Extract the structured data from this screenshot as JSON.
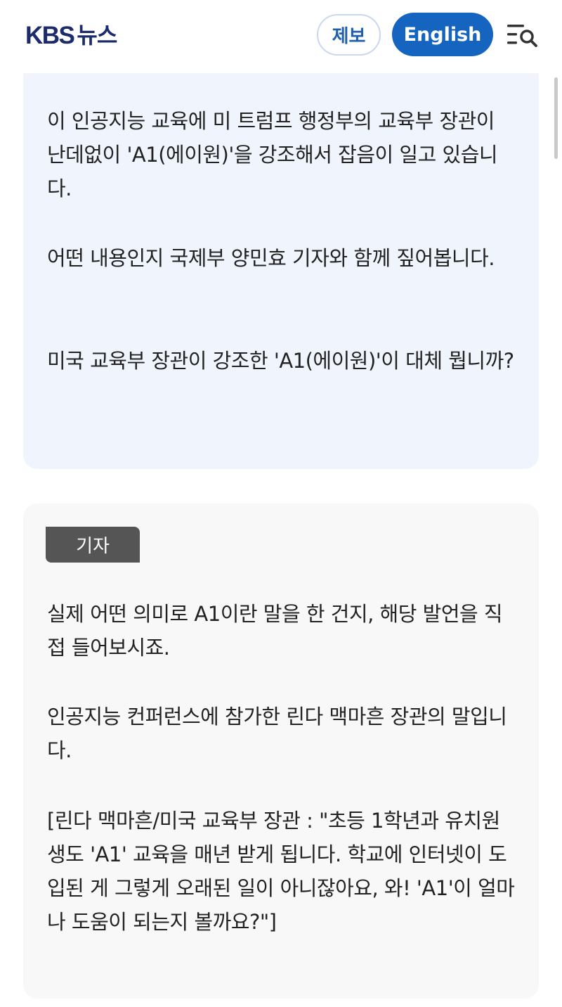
{
  "header": {
    "logo_kbs": "KBS",
    "logo_news": "뉴스",
    "tip_button": "제보",
    "english_button": "English",
    "menu_icon": "menu-search-icon",
    "reading_progress": 0.21,
    "colors": {
      "brand": "#1c2b6b",
      "accent": "#1565c0",
      "progress": "#2f92d6"
    }
  },
  "anchor_card": {
    "paragraphs": [
      "이 인공지능 교육에 미 트럼프 행정부의 교육부 장관이 난데없이 'A1(에이원)'을 강조해서 잡음이 일고 있습니다.",
      "어떤 내용인지 국제부 양민효 기자와 함께 짚어봅니다.",
      "미국 교육부 장관이 강조한 'A1(에이원)'이 대체 뭡니까?"
    ]
  },
  "reporter_card": {
    "role_label": "기자",
    "paragraphs": [
      "실제 어떤 의미로 A1이란 말을 한 건지, 해당 발언을 직접 들어보시죠.",
      "인공지능 컨퍼런스에 참가한 린다 맥마흔 장관의 말입니다.",
      "[린다 맥마흔/미국 교육부 장관 : \"초등 1학년과 유치원생도 'A1' 교육을 매년 받게 됩니다. 학교에 인터넷이 도입된 게 그렇게 오래된 일이 아니잖아요, 와! 'A1'이 얼마나 도움이 되는지 볼까요?\"]"
    ]
  }
}
